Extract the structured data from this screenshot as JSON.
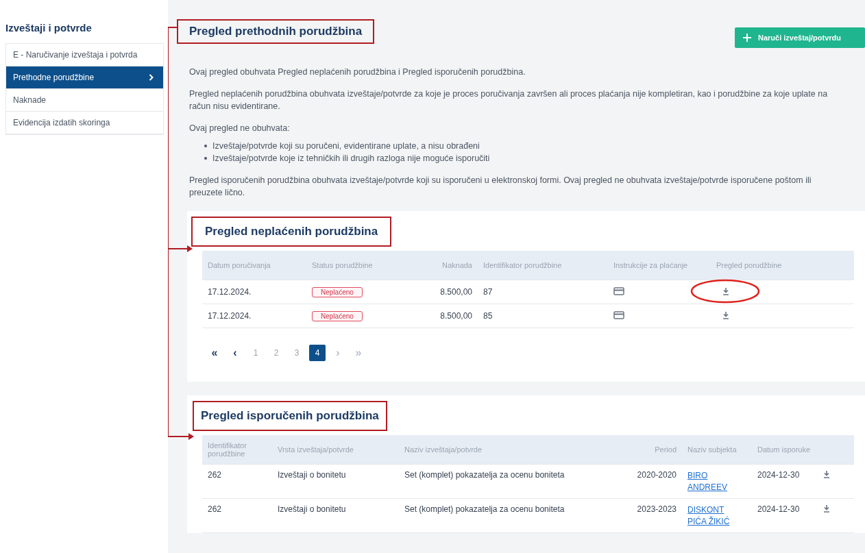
{
  "sidebar": {
    "title": "Izveštaji i potvrde",
    "items": [
      {
        "label": "E - Naručivanje izveštaja i potvrda",
        "selected": false
      },
      {
        "label": "Prethodne porudžbine",
        "selected": true
      },
      {
        "label": "Naknade",
        "selected": false
      },
      {
        "label": "Evidencija izdatih skoringa",
        "selected": false
      }
    ]
  },
  "page": {
    "title": "Pregled prethodnih porudžbina",
    "order_button": "Naruči izveštaj/potvrdu",
    "paragraphs": [
      {
        "kind": "text",
        "text": "Ovaj pregled obuhvata Pregled neplaćenih porudžbina i Pregled isporučenih porudžbina."
      },
      {
        "kind": "text",
        "text": "Pregled neplaćenih porudžbina obuhvata izveštaje/potvrde za koje je proces poručivanja završen ali proces plaćanja nije kompletiran, kao i porudžbine za koje uplate na račun nisu evidentirane."
      },
      {
        "kind": "list",
        "text": "Ovaj pregled ne obuhvata:",
        "items": [
          "Izveštaje/potvrde koji su poručeni, evidentirane uplate, a nisu obrađeni",
          "Izveštaje/potvrde koje iz tehničkih ili drugih razloga nije moguće isporučiti"
        ]
      },
      {
        "kind": "text",
        "text": "Pregled isporučenih porudžbina obuhvata izveštaje/potvrde koji su isporučeni u elektronskoj formi. Ovaj pregled ne obuhvata izveštaje/potvrde isporučene poštom ili preuzete lično."
      }
    ]
  },
  "unpaid": {
    "title": "Pregled neplaćenih porudžbina",
    "columns": [
      "Datum poručivanja",
      "Status porudžbine",
      "Naknada",
      "Identifikator porudžbine",
      "Instrukcije za plaćanje",
      "Pregled porudžbine"
    ],
    "rows": [
      {
        "date": "17.12.2024.",
        "status": "Neplaćeno",
        "fee": "8.500,00",
        "id": "87",
        "circled": true
      },
      {
        "date": "17.12.2024.",
        "status": "Neplaćeno",
        "fee": "8.500,00",
        "id": "85",
        "circled": false
      }
    ],
    "pagination": [
      {
        "label": "«",
        "kind": "nav",
        "selected": false,
        "disabled": false
      },
      {
        "label": "‹",
        "kind": "nav",
        "selected": false,
        "disabled": false
      },
      {
        "label": "1",
        "kind": "page",
        "selected": false,
        "disabled": false
      },
      {
        "label": "2",
        "kind": "page",
        "selected": false,
        "disabled": false
      },
      {
        "label": "3",
        "kind": "page",
        "selected": false,
        "disabled": false
      },
      {
        "label": "4",
        "kind": "page",
        "selected": true,
        "disabled": false
      },
      {
        "label": "›",
        "kind": "nav",
        "selected": false,
        "disabled": true
      },
      {
        "label": "»",
        "kind": "nav",
        "selected": false,
        "disabled": true
      }
    ]
  },
  "delivered": {
    "title": "Pregled isporučenih porudžbina",
    "columns": [
      "Identifikator porudžbine",
      "Vrsta izveštaja/potvrde",
      "Naziv izveštaja/potvrde",
      "Period",
      "Naziv subjekta",
      "Datum isporuke"
    ],
    "rows": [
      {
        "id": "262",
        "type": "Izveštaji o bonitetu",
        "name": "Set (komplet) pokazatelja za ocenu boniteta",
        "period": "2020-2020",
        "subject": "BIRO ANDREEV",
        "date": "2024-12-30"
      },
      {
        "id": "262",
        "type": "Izveštaji o bonitetu",
        "name": "Set (komplet) pokazatelja za ocenu boniteta",
        "period": "2023-2023",
        "subject": "DISKONT PIĆA ŽIKIĆ",
        "date": "2024-12-30"
      }
    ]
  }
}
